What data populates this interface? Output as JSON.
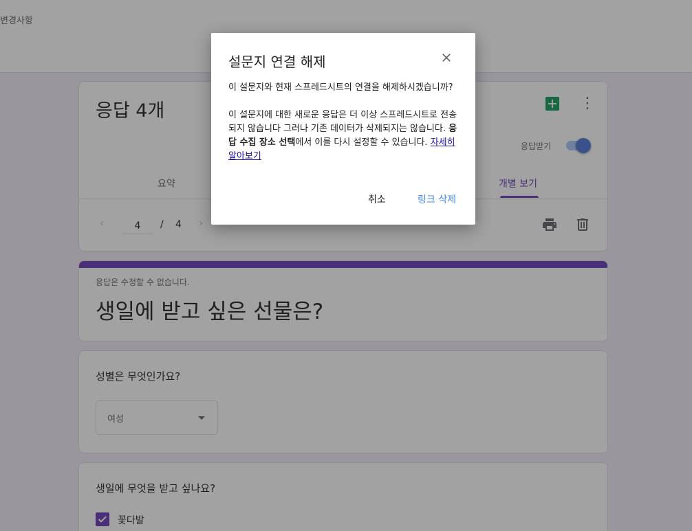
{
  "topbar": {
    "text": "변경사항"
  },
  "responses": {
    "title": "응답 4개",
    "accept_label": "응답받기",
    "tabs": [
      {
        "label": "요약"
      },
      {
        "label": "개별 보기"
      }
    ],
    "pager": {
      "current": "4",
      "separator": "/",
      "total": "4"
    }
  },
  "form": {
    "note": "응답은 수정할 수 없습니다.",
    "title": "생일에 받고 싶은 선물은?"
  },
  "questions": [
    {
      "label": "성별은 무엇인가요?",
      "selected": "여성"
    },
    {
      "label": "생일에 무엇을 받고 싶나요?",
      "option": "꽃다발"
    }
  ],
  "dialog": {
    "title": "설문지 연결 해제",
    "para1": "이 설문지와 현재 스프레드시트의 연결을 해제하시겠습니까?",
    "para2_a": "이 설문지에 대한 새로운 응답은 더 이상 스프레드시트로 전송되지 않습니다 그러나 기존 데이터가 삭제되지는 않습니다. ",
    "para2_bold": "응답 수집 장소 선택",
    "para2_b": "에서 이를 다시 설정할 수 있습니다. ",
    "learn_more": "자세히 알아보기",
    "cancel": "취소",
    "delete": "링크 삭제"
  },
  "colors": {
    "accent": "#673ab7",
    "link_blue": "#4285f4",
    "sheets_green": "#0f9d58",
    "background": "#efebf6"
  },
  "icons": [
    "sheets-icon",
    "more-vert-icon",
    "chevron-left-icon",
    "chevron-right-icon",
    "print-icon",
    "trash-icon",
    "close-icon",
    "dropdown-arrow-icon",
    "check-icon"
  ]
}
